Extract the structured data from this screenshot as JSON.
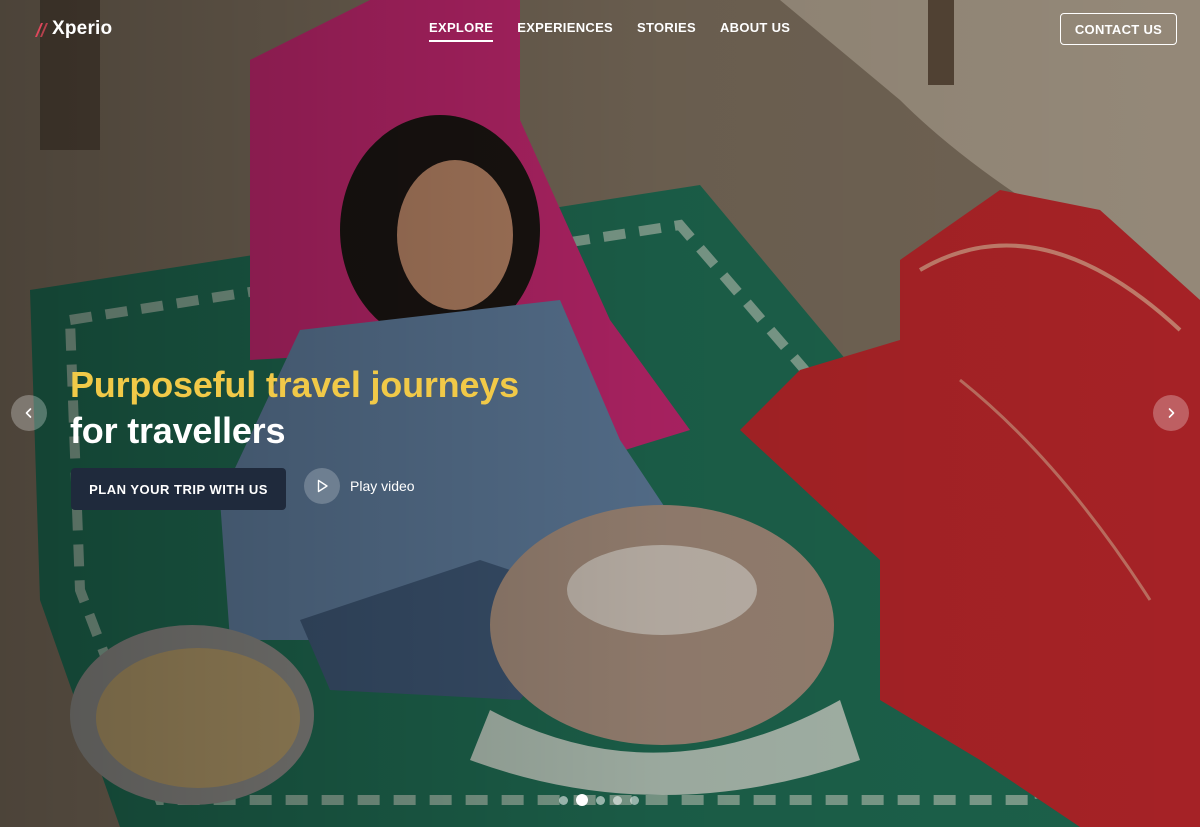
{
  "brand": {
    "name": "Xperio",
    "accent": "#e0475b"
  },
  "nav": {
    "items": [
      {
        "label": "EXPLORE",
        "active": true
      },
      {
        "label": "EXPERIENCES",
        "active": false
      },
      {
        "label": "STORIES",
        "active": false
      },
      {
        "label": "ABOUT US",
        "active": false
      }
    ],
    "contact_label": "CONTACT US"
  },
  "hero": {
    "headline_line1": "Purposeful travel journeys",
    "headline_line2": "for travellers",
    "headline_highlight_color": "#f1c948",
    "cta_label": "PLAN YOUR TRIP WITH US",
    "play_label": "Play video",
    "prev_icon": "chevron-left-icon",
    "next_icon": "chevron-right-icon",
    "slides": {
      "count": 5,
      "active_index": 1
    }
  }
}
